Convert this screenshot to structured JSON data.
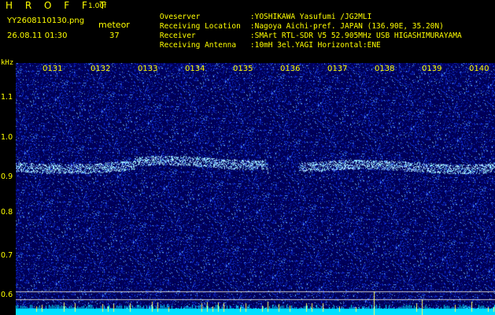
{
  "header": {
    "title": "H R O F F T",
    "version": "1.00f",
    "filename": "YY2608110130.png",
    "datetime": "26.08.11 01:30",
    "meteor_label": "meteor",
    "meteor_count": "37"
  },
  "info": [
    {
      "label": "Oveserver",
      "value": ":YOSHIKAWA Yasufumi /JG2MLI"
    },
    {
      "label": "Receiving Location",
      "value": ":Nagoya Aichi-pref. JAPAN (136.90E, 35.20N)"
    },
    {
      "label": "Receiver",
      "value": ":SMArt RTL-SDR V5 52.905MHz USB HIGASHIMURAYAMA"
    },
    {
      "label": "Receiving Antenna",
      "value": ":10mH 3el.YAGI Horizontal:ENE"
    }
  ],
  "spectrogram": {
    "y_unit": "kHz",
    "y_ticks": [
      "1.1",
      "1.0",
      "0.9",
      "0.8",
      "0.7",
      "0.6"
    ],
    "x_ticks": [
      "0131",
      "0132",
      "0133",
      "0134",
      "0135",
      "0136",
      "0137",
      "0138",
      "0139",
      "0140"
    ],
    "colors": {
      "background": "#000066",
      "noise": "#1a2fcc",
      "signal": "#66ccff",
      "axis": "#ffff00",
      "baseline": "#00ffff"
    }
  }
}
